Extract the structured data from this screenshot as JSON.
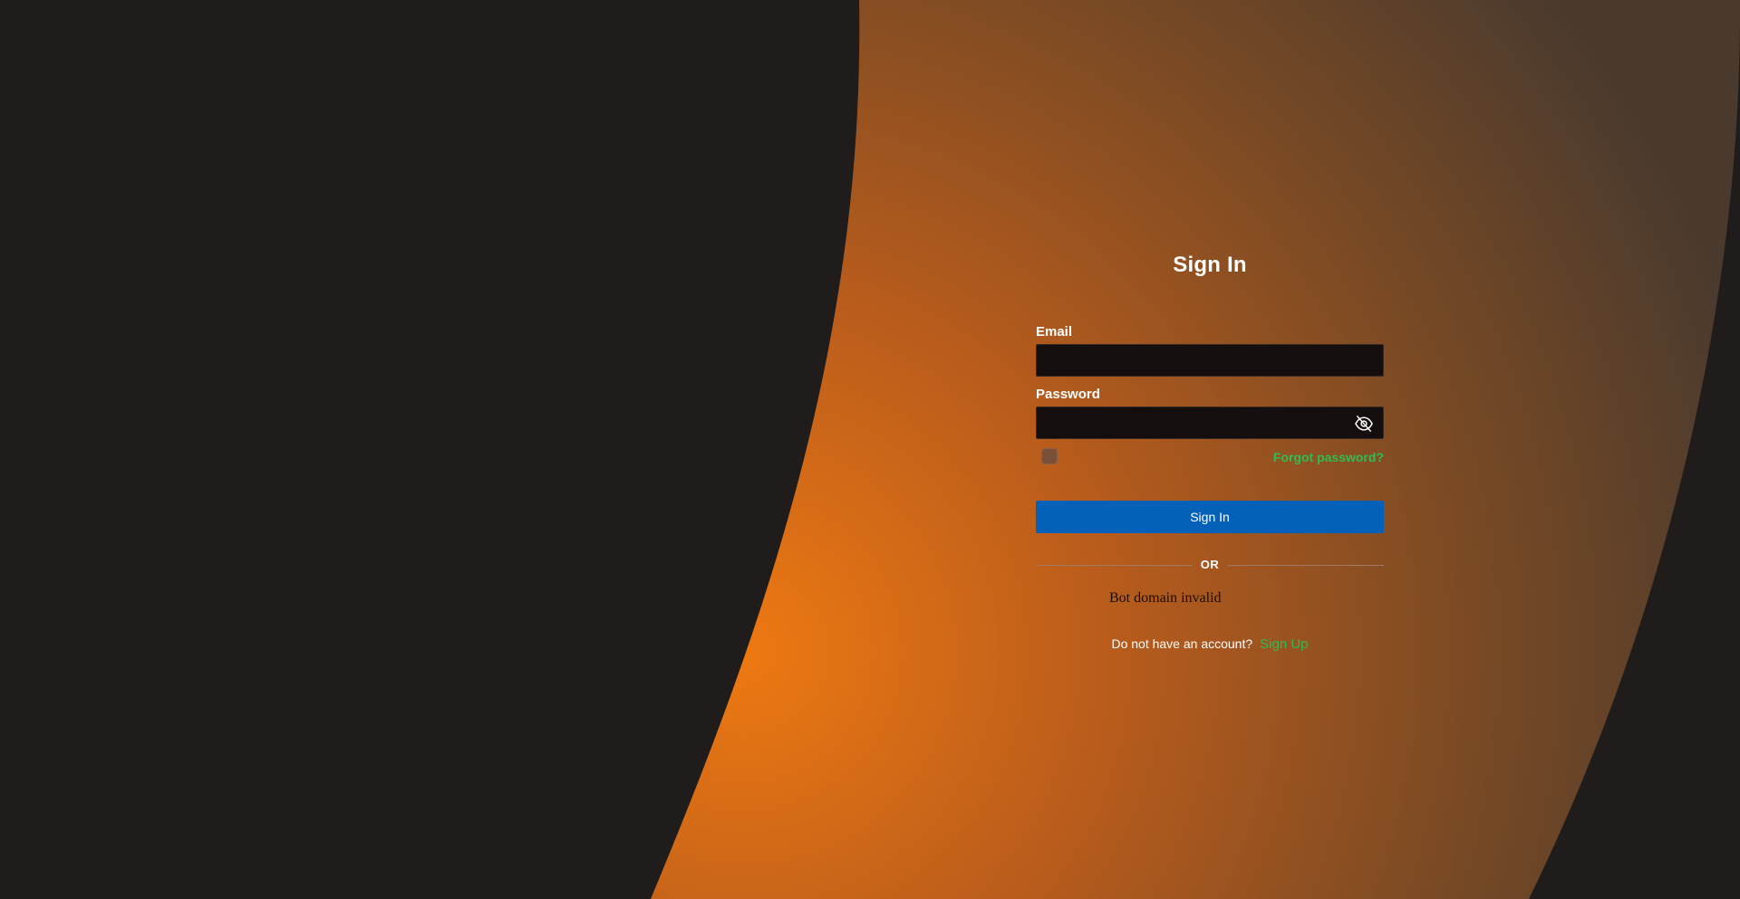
{
  "colors": {
    "background": "#1f1c1b",
    "accent_orange": "#e8740f",
    "link_green": "#2dbd55",
    "button_blue": "#0561b7",
    "field_bg": "#140f0e"
  },
  "form": {
    "title": "Sign In",
    "email": {
      "label": "Email",
      "value": "",
      "placeholder": ""
    },
    "password": {
      "label": "Password",
      "value": "",
      "placeholder": "",
      "toggle_icon": "eye-off-icon"
    },
    "remember_checked": false,
    "forgot_label": "Forgot password?",
    "submit_label": "Sign In",
    "divider_label": "OR",
    "bot_message": "Bot domain invalid",
    "signup_prompt": "Do not have an account?",
    "signup_label": "Sign Up"
  }
}
